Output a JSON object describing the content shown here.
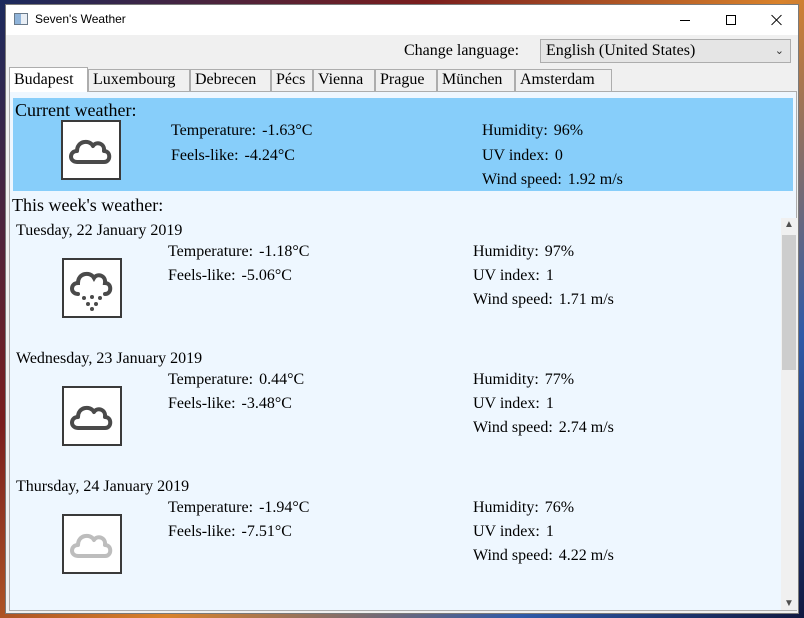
{
  "window": {
    "title": "Seven's Weather"
  },
  "language": {
    "label": "Change language:",
    "selected": "English (United States)"
  },
  "tabs": [
    "Budapest",
    "Luxembourg",
    "Debrecen",
    "Pécs",
    "Vienna",
    "Prague",
    "München",
    "Amsterdam"
  ],
  "active_tab": "Budapest",
  "labels": {
    "temperature": "Temperature:",
    "feels_like": "Feels-like:",
    "humidity": "Humidity:",
    "uv_index": "UV index:",
    "wind_speed": "Wind speed:"
  },
  "current": {
    "heading": "Current weather:",
    "icon": "cloud-icon",
    "temperature": "-1.63°C",
    "feels_like": "-4.24°C",
    "humidity": "96%",
    "uv_index": "0",
    "wind_speed": "1.92 m/s"
  },
  "week": {
    "heading": "This week's weather:",
    "days": [
      {
        "date": "Tuesday, 22 January 2019",
        "icon": "cloud-snow-icon",
        "temperature": "-1.18°C",
        "feels_like": "-5.06°C",
        "humidity": "97%",
        "uv_index": "1",
        "wind_speed": "1.71 m/s"
      },
      {
        "date": "Wednesday, 23 January 2019",
        "icon": "cloud-icon",
        "temperature": "0.44°C",
        "feels_like": "-3.48°C",
        "humidity": "77%",
        "uv_index": "1",
        "wind_speed": "2.74 m/s"
      },
      {
        "date": "Thursday, 24 January 2019",
        "icon": "cloud-light-icon",
        "temperature": "-1.94°C",
        "feels_like": "-7.51°C",
        "humidity": "76%",
        "uv_index": "1",
        "wind_speed": "4.22 m/s"
      }
    ]
  },
  "colors": {
    "current_bg": "#87cefa",
    "week_bg": "#eef7ff"
  }
}
